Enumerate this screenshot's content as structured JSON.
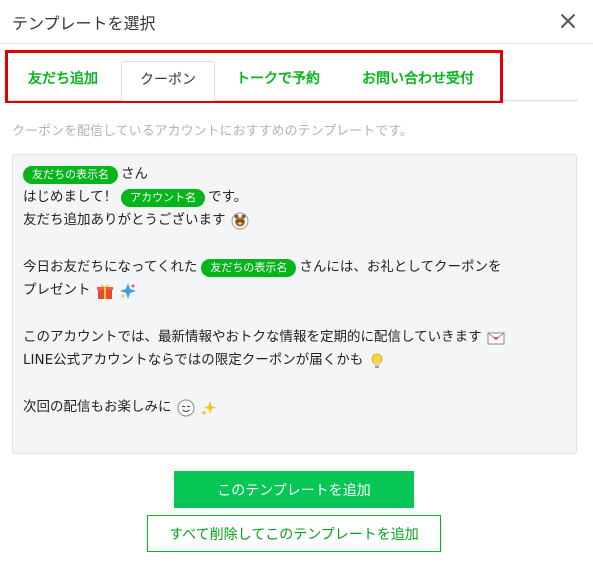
{
  "dialog": {
    "title": "テンプレートを選択",
    "close_icon": "close-icon"
  },
  "tabs": [
    {
      "label": "友だち追加",
      "active": false
    },
    {
      "label": "クーポン",
      "active": true
    },
    {
      "label": "トークで予約",
      "active": false
    },
    {
      "label": "お問い合わせ受付",
      "active": false
    }
  ],
  "hint": "クーポンを配信しているアカウントにおすすめのテンプレートです。",
  "message": {
    "l1_pill": "友だちの表示名",
    "l1_text": "さん",
    "l2_text_a": "はじめまして！",
    "l2_pill": "アカウント名",
    "l2_text_b": "です。",
    "l3_text": "友だち追加ありがとうございます",
    "l4_text_a": "今日お友だちになってくれた",
    "l4_pill": "友だちの表示名",
    "l4_text_b": "さんには、お礼としてクーポンを",
    "l5_text": "プレゼント",
    "l6_text": "このアカウントでは、最新情報やおトクな情報を定期的に配信していきます",
    "l7_text": "LINE公式アカウントならではの限定クーポンが届くかも",
    "l8_text": "次回の配信もお楽しみに",
    "emoji": {
      "l3": "bear-emoji",
      "l5a": "gift-emoji",
      "l5b": "sparkle-star-emoji",
      "l6": "envelope-emoji",
      "l7": "lightbulb-emoji",
      "l8a": "smiling-face-emoji",
      "l8b": "sparkles-emoji"
    }
  },
  "buttons": {
    "add_template": "このテンプレートを追加",
    "delete_all_and_add": "すべて削除してこのテンプレートを追加"
  },
  "colors": {
    "accent_green": "#06c755",
    "pill_green": "#06b51c",
    "highlight_red": "#e00000"
  }
}
